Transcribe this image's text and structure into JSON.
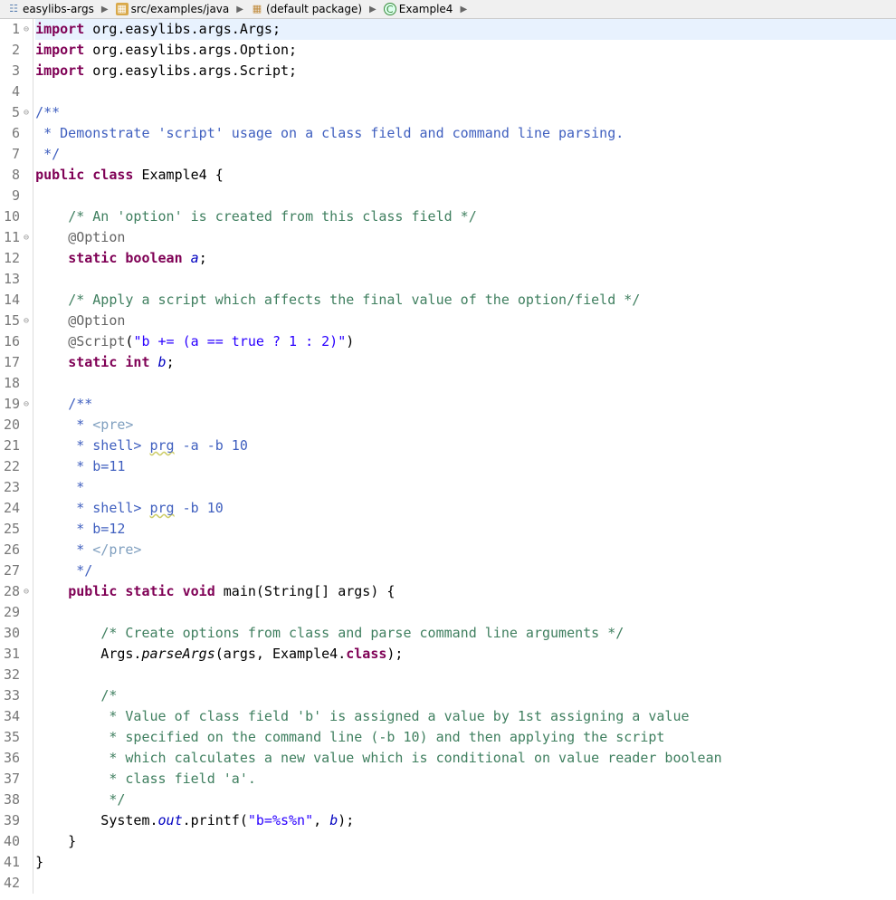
{
  "breadcrumb": {
    "items": [
      {
        "label": "easylibs-args",
        "icon": "proj"
      },
      {
        "label": "src/examples/java",
        "icon": "folder"
      },
      {
        "label": "(default package)",
        "icon": "pkg"
      },
      {
        "label": "Example4",
        "icon": "class"
      }
    ]
  },
  "code": {
    "lines": [
      {
        "n": "1",
        "fold": "⊖",
        "hl": true,
        "tokens": [
          [
            "kw",
            "import"
          ],
          [
            "plain",
            " org.easylibs.args.Args;"
          ]
        ]
      },
      {
        "n": "2",
        "fold": "",
        "tokens": [
          [
            "kw",
            "import"
          ],
          [
            "plain",
            " org.easylibs.args.Option;"
          ]
        ]
      },
      {
        "n": "3",
        "fold": "",
        "tokens": [
          [
            "kw",
            "import"
          ],
          [
            "plain",
            " org.easylibs.args.Script;"
          ]
        ]
      },
      {
        "n": "4",
        "fold": "",
        "tokens": []
      },
      {
        "n": "5",
        "fold": "⊖",
        "tokens": [
          [
            "doc",
            "/**"
          ]
        ]
      },
      {
        "n": "6",
        "fold": "",
        "tokens": [
          [
            "doc",
            " * Demonstrate 'script' usage on a class field and command line parsing."
          ]
        ]
      },
      {
        "n": "7",
        "fold": "",
        "tokens": [
          [
            "doc",
            " */"
          ]
        ]
      },
      {
        "n": "8",
        "fold": "",
        "tokens": [
          [
            "kw",
            "public"
          ],
          [
            "plain",
            " "
          ],
          [
            "kw",
            "class"
          ],
          [
            "plain",
            " Example4 {"
          ]
        ]
      },
      {
        "n": "9",
        "fold": "",
        "tokens": []
      },
      {
        "n": "10",
        "fold": "",
        "tokens": [
          [
            "plain",
            "    "
          ],
          [
            "cm",
            "/* An 'option' is created from this class field */"
          ]
        ]
      },
      {
        "n": "11",
        "fold": "⊖",
        "tokens": [
          [
            "plain",
            "    "
          ],
          [
            "ann",
            "@Option"
          ]
        ]
      },
      {
        "n": "12",
        "fold": "",
        "tokens": [
          [
            "plain",
            "    "
          ],
          [
            "kw",
            "static"
          ],
          [
            "plain",
            " "
          ],
          [
            "kw",
            "boolean"
          ],
          [
            "plain",
            " "
          ],
          [
            "fld",
            "a"
          ],
          [
            "plain",
            ";"
          ]
        ]
      },
      {
        "n": "13",
        "fold": "",
        "tokens": []
      },
      {
        "n": "14",
        "fold": "",
        "tokens": [
          [
            "plain",
            "    "
          ],
          [
            "cm",
            "/* Apply a script which affects the final value of the option/field */"
          ]
        ]
      },
      {
        "n": "15",
        "fold": "⊖",
        "tokens": [
          [
            "plain",
            "    "
          ],
          [
            "ann",
            "@Option"
          ]
        ]
      },
      {
        "n": "16",
        "fold": "",
        "tokens": [
          [
            "plain",
            "    "
          ],
          [
            "ann",
            "@Script"
          ],
          [
            "plain",
            "("
          ],
          [
            "str",
            "\"b += (a == true ? 1 : 2)\""
          ],
          [
            "plain",
            ")"
          ]
        ]
      },
      {
        "n": "17",
        "fold": "",
        "tokens": [
          [
            "plain",
            "    "
          ],
          [
            "kw",
            "static"
          ],
          [
            "plain",
            " "
          ],
          [
            "kw",
            "int"
          ],
          [
            "plain",
            " "
          ],
          [
            "fld",
            "b"
          ],
          [
            "plain",
            ";"
          ]
        ]
      },
      {
        "n": "18",
        "fold": "",
        "tokens": []
      },
      {
        "n": "19",
        "fold": "⊖",
        "tokens": [
          [
            "plain",
            "    "
          ],
          [
            "doc",
            "/**"
          ]
        ]
      },
      {
        "n": "20",
        "fold": "",
        "tokens": [
          [
            "plain",
            "    "
          ],
          [
            "doc",
            " * "
          ],
          [
            "doctag",
            "<pre>"
          ]
        ]
      },
      {
        "n": "21",
        "fold": "",
        "tokens": [
          [
            "plain",
            "    "
          ],
          [
            "doc",
            " * shell> "
          ],
          [
            "doc err",
            "prg"
          ],
          [
            "doc",
            " -a -b 10"
          ]
        ]
      },
      {
        "n": "22",
        "fold": "",
        "tokens": [
          [
            "plain",
            "    "
          ],
          [
            "doc",
            " * b=11"
          ]
        ]
      },
      {
        "n": "23",
        "fold": "",
        "tokens": [
          [
            "plain",
            "    "
          ],
          [
            "doc",
            " * "
          ]
        ]
      },
      {
        "n": "24",
        "fold": "",
        "tokens": [
          [
            "plain",
            "    "
          ],
          [
            "doc",
            " * shell> "
          ],
          [
            "doc err",
            "prg"
          ],
          [
            "doc",
            " -b 10"
          ]
        ]
      },
      {
        "n": "25",
        "fold": "",
        "tokens": [
          [
            "plain",
            "    "
          ],
          [
            "doc",
            " * b=12"
          ]
        ]
      },
      {
        "n": "26",
        "fold": "",
        "tokens": [
          [
            "plain",
            "    "
          ],
          [
            "doc",
            " * "
          ],
          [
            "doctag",
            "</pre>"
          ]
        ]
      },
      {
        "n": "27",
        "fold": "",
        "tokens": [
          [
            "plain",
            "    "
          ],
          [
            "doc",
            " */"
          ]
        ]
      },
      {
        "n": "28",
        "fold": "⊖",
        "tokens": [
          [
            "plain",
            "    "
          ],
          [
            "kw",
            "public"
          ],
          [
            "plain",
            " "
          ],
          [
            "kw",
            "static"
          ],
          [
            "plain",
            " "
          ],
          [
            "kw",
            "void"
          ],
          [
            "plain",
            " main(String[] args) {"
          ]
        ]
      },
      {
        "n": "29",
        "fold": "",
        "tokens": []
      },
      {
        "n": "30",
        "fold": "",
        "tokens": [
          [
            "plain",
            "        "
          ],
          [
            "cm",
            "/* Create options from class and parse command line arguments */"
          ]
        ]
      },
      {
        "n": "31",
        "fold": "",
        "tokens": [
          [
            "plain",
            "        Args."
          ],
          [
            "mth",
            "parseArgs"
          ],
          [
            "plain",
            "(args, Example4."
          ],
          [
            "kw",
            "class"
          ],
          [
            "plain",
            ");"
          ]
        ]
      },
      {
        "n": "32",
        "fold": "",
        "tokens": []
      },
      {
        "n": "33",
        "fold": "",
        "tokens": [
          [
            "plain",
            "        "
          ],
          [
            "cm",
            "/*"
          ]
        ]
      },
      {
        "n": "34",
        "fold": "",
        "tokens": [
          [
            "plain",
            "        "
          ],
          [
            "cm",
            " * Value of class field 'b' is assigned a value by 1st assigning a value"
          ]
        ]
      },
      {
        "n": "35",
        "fold": "",
        "tokens": [
          [
            "plain",
            "        "
          ],
          [
            "cm",
            " * specified on the command line (-b 10) and then applying the script"
          ]
        ]
      },
      {
        "n": "36",
        "fold": "",
        "tokens": [
          [
            "plain",
            "        "
          ],
          [
            "cm",
            " * which calculates a new value which is conditional on value reader boolean"
          ]
        ]
      },
      {
        "n": "37",
        "fold": "",
        "tokens": [
          [
            "plain",
            "        "
          ],
          [
            "cm",
            " * class field 'a'."
          ]
        ]
      },
      {
        "n": "38",
        "fold": "",
        "tokens": [
          [
            "plain",
            "        "
          ],
          [
            "cm",
            " */"
          ]
        ]
      },
      {
        "n": "39",
        "fold": "",
        "tokens": [
          [
            "plain",
            "        System."
          ],
          [
            "fld",
            "out"
          ],
          [
            "plain",
            ".printf("
          ],
          [
            "str",
            "\"b=%s%n\""
          ],
          [
            "plain",
            ", "
          ],
          [
            "fld",
            "b"
          ],
          [
            "plain",
            ");"
          ]
        ]
      },
      {
        "n": "40",
        "fold": "",
        "tokens": [
          [
            "plain",
            "    }"
          ]
        ]
      },
      {
        "n": "41",
        "fold": "",
        "tokens": [
          [
            "plain",
            "}"
          ]
        ]
      },
      {
        "n": "42",
        "fold": "",
        "tokens": []
      }
    ]
  }
}
